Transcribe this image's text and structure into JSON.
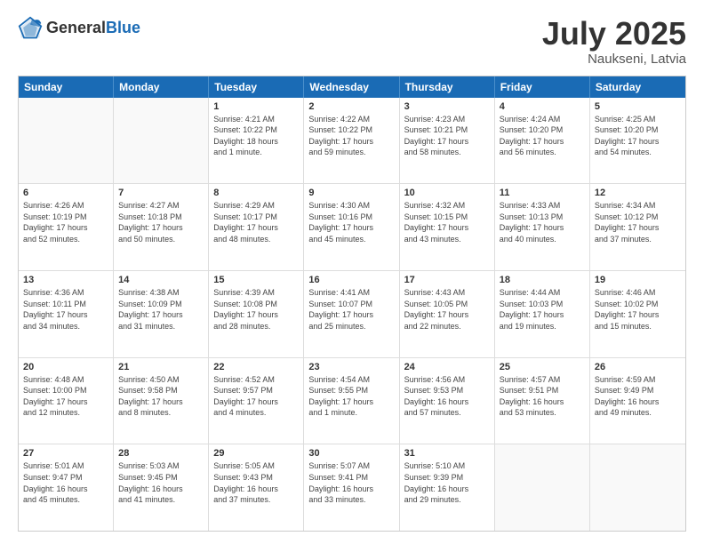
{
  "header": {
    "logo_general": "General",
    "logo_blue": "Blue",
    "main_title": "July 2025",
    "subtitle": "Naukseni, Latvia"
  },
  "calendar": {
    "days_of_week": [
      "Sunday",
      "Monday",
      "Tuesday",
      "Wednesday",
      "Thursday",
      "Friday",
      "Saturday"
    ],
    "weeks": [
      [
        {
          "day": "",
          "content": ""
        },
        {
          "day": "",
          "content": ""
        },
        {
          "day": "1",
          "content": "Sunrise: 4:21 AM\nSunset: 10:22 PM\nDaylight: 18 hours\nand 1 minute."
        },
        {
          "day": "2",
          "content": "Sunrise: 4:22 AM\nSunset: 10:22 PM\nDaylight: 17 hours\nand 59 minutes."
        },
        {
          "day": "3",
          "content": "Sunrise: 4:23 AM\nSunset: 10:21 PM\nDaylight: 17 hours\nand 58 minutes."
        },
        {
          "day": "4",
          "content": "Sunrise: 4:24 AM\nSunset: 10:20 PM\nDaylight: 17 hours\nand 56 minutes."
        },
        {
          "day": "5",
          "content": "Sunrise: 4:25 AM\nSunset: 10:20 PM\nDaylight: 17 hours\nand 54 minutes."
        }
      ],
      [
        {
          "day": "6",
          "content": "Sunrise: 4:26 AM\nSunset: 10:19 PM\nDaylight: 17 hours\nand 52 minutes."
        },
        {
          "day": "7",
          "content": "Sunrise: 4:27 AM\nSunset: 10:18 PM\nDaylight: 17 hours\nand 50 minutes."
        },
        {
          "day": "8",
          "content": "Sunrise: 4:29 AM\nSunset: 10:17 PM\nDaylight: 17 hours\nand 48 minutes."
        },
        {
          "day": "9",
          "content": "Sunrise: 4:30 AM\nSunset: 10:16 PM\nDaylight: 17 hours\nand 45 minutes."
        },
        {
          "day": "10",
          "content": "Sunrise: 4:32 AM\nSunset: 10:15 PM\nDaylight: 17 hours\nand 43 minutes."
        },
        {
          "day": "11",
          "content": "Sunrise: 4:33 AM\nSunset: 10:13 PM\nDaylight: 17 hours\nand 40 minutes."
        },
        {
          "day": "12",
          "content": "Sunrise: 4:34 AM\nSunset: 10:12 PM\nDaylight: 17 hours\nand 37 minutes."
        }
      ],
      [
        {
          "day": "13",
          "content": "Sunrise: 4:36 AM\nSunset: 10:11 PM\nDaylight: 17 hours\nand 34 minutes."
        },
        {
          "day": "14",
          "content": "Sunrise: 4:38 AM\nSunset: 10:09 PM\nDaylight: 17 hours\nand 31 minutes."
        },
        {
          "day": "15",
          "content": "Sunrise: 4:39 AM\nSunset: 10:08 PM\nDaylight: 17 hours\nand 28 minutes."
        },
        {
          "day": "16",
          "content": "Sunrise: 4:41 AM\nSunset: 10:07 PM\nDaylight: 17 hours\nand 25 minutes."
        },
        {
          "day": "17",
          "content": "Sunrise: 4:43 AM\nSunset: 10:05 PM\nDaylight: 17 hours\nand 22 minutes."
        },
        {
          "day": "18",
          "content": "Sunrise: 4:44 AM\nSunset: 10:03 PM\nDaylight: 17 hours\nand 19 minutes."
        },
        {
          "day": "19",
          "content": "Sunrise: 4:46 AM\nSunset: 10:02 PM\nDaylight: 17 hours\nand 15 minutes."
        }
      ],
      [
        {
          "day": "20",
          "content": "Sunrise: 4:48 AM\nSunset: 10:00 PM\nDaylight: 17 hours\nand 12 minutes."
        },
        {
          "day": "21",
          "content": "Sunrise: 4:50 AM\nSunset: 9:58 PM\nDaylight: 17 hours\nand 8 minutes."
        },
        {
          "day": "22",
          "content": "Sunrise: 4:52 AM\nSunset: 9:57 PM\nDaylight: 17 hours\nand 4 minutes."
        },
        {
          "day": "23",
          "content": "Sunrise: 4:54 AM\nSunset: 9:55 PM\nDaylight: 17 hours\nand 1 minute."
        },
        {
          "day": "24",
          "content": "Sunrise: 4:56 AM\nSunset: 9:53 PM\nDaylight: 16 hours\nand 57 minutes."
        },
        {
          "day": "25",
          "content": "Sunrise: 4:57 AM\nSunset: 9:51 PM\nDaylight: 16 hours\nand 53 minutes."
        },
        {
          "day": "26",
          "content": "Sunrise: 4:59 AM\nSunset: 9:49 PM\nDaylight: 16 hours\nand 49 minutes."
        }
      ],
      [
        {
          "day": "27",
          "content": "Sunrise: 5:01 AM\nSunset: 9:47 PM\nDaylight: 16 hours\nand 45 minutes."
        },
        {
          "day": "28",
          "content": "Sunrise: 5:03 AM\nSunset: 9:45 PM\nDaylight: 16 hours\nand 41 minutes."
        },
        {
          "day": "29",
          "content": "Sunrise: 5:05 AM\nSunset: 9:43 PM\nDaylight: 16 hours\nand 37 minutes."
        },
        {
          "day": "30",
          "content": "Sunrise: 5:07 AM\nSunset: 9:41 PM\nDaylight: 16 hours\nand 33 minutes."
        },
        {
          "day": "31",
          "content": "Sunrise: 5:10 AM\nSunset: 9:39 PM\nDaylight: 16 hours\nand 29 minutes."
        },
        {
          "day": "",
          "content": ""
        },
        {
          "day": "",
          "content": ""
        }
      ]
    ]
  }
}
